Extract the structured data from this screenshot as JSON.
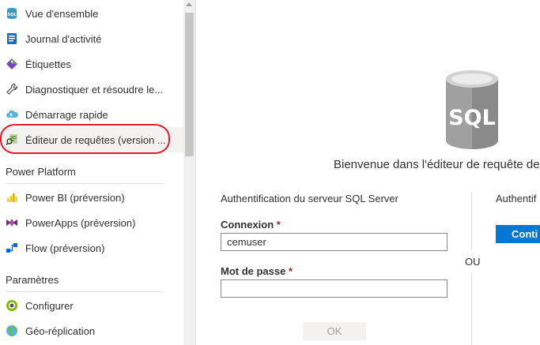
{
  "nav": {
    "items_top": [
      {
        "label": "Vue d'ensemble",
        "icon": "sql-database-icon"
      },
      {
        "label": "Journal d'activité",
        "icon": "activity-log-icon"
      },
      {
        "label": "Étiquettes",
        "icon": "tag-icon"
      },
      {
        "label": "Diagnostiquer et résoudre le...",
        "icon": "wrench-icon"
      },
      {
        "label": "Démarrage rapide",
        "icon": "cloud-quickstart-icon"
      },
      {
        "label": "Éditeur de requêtes (version ...",
        "icon": "query-editor-icon"
      }
    ],
    "section_power": "Power Platform",
    "items_power": [
      {
        "label": "Power BI (préversion)",
        "icon": "power-bi-icon"
      },
      {
        "label": "PowerApps (préversion)",
        "icon": "powerapps-icon"
      },
      {
        "label": "Flow (préversion)",
        "icon": "flow-icon"
      }
    ],
    "section_params": "Paramètres",
    "items_params": [
      {
        "label": "Configurer",
        "icon": "configure-icon"
      },
      {
        "label": "Géo-réplication",
        "icon": "globe-icon"
      }
    ]
  },
  "main": {
    "sql_art_text": "SQL",
    "welcome": "Bienvenue dans l'éditeur de requête de",
    "auth_title": "Authentification du serveur SQL Server",
    "login_label": "Connexion",
    "login_value": "cemuser",
    "password_label": "Mot de passe",
    "password_value": "",
    "required_mark": "*",
    "ok_label": "OK",
    "or_text": "OU",
    "auth_right": "Authentif",
    "continue_label": "Conti"
  },
  "colors": {
    "accent": "#0078d4",
    "highlight_ring": "#e01c2c",
    "required": "#a4262c"
  }
}
